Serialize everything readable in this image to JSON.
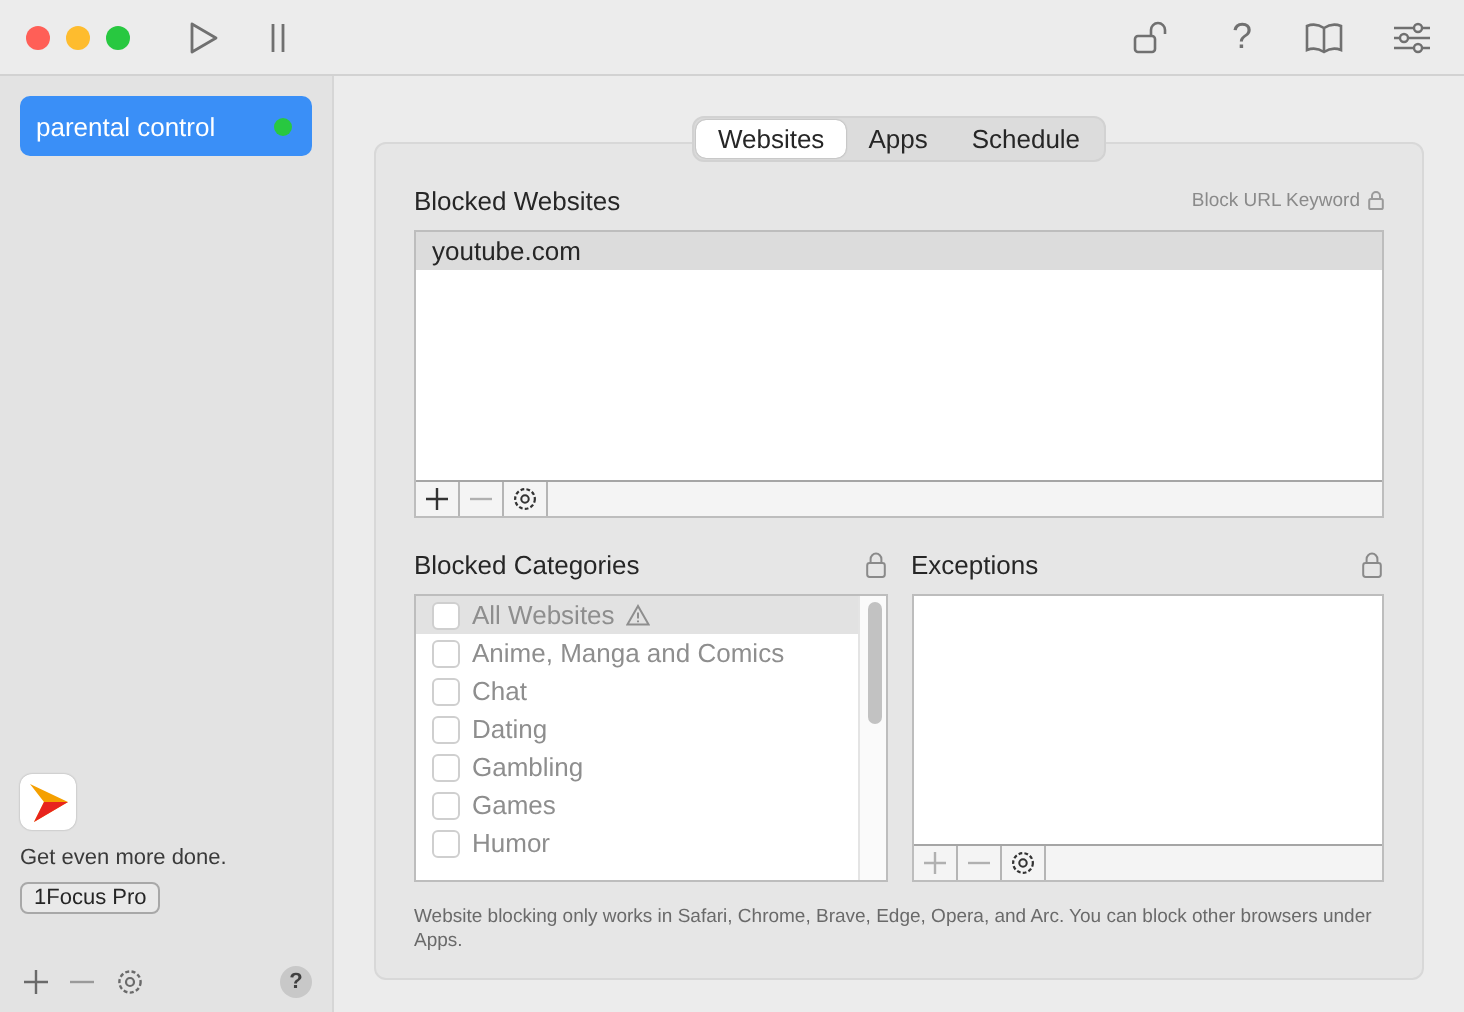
{
  "toolbar": {
    "help_label": "?"
  },
  "sidebar": {
    "items": [
      {
        "label": "parental control",
        "selected": true,
        "color": "#28c840"
      }
    ],
    "promo": {
      "text": "Get even more done.",
      "button": "1Focus Pro"
    },
    "footer": {
      "help_label": "?"
    }
  },
  "tabs": [
    {
      "label": "Websites",
      "selected": true
    },
    {
      "label": "Apps",
      "selected": false
    },
    {
      "label": "Schedule",
      "selected": false
    }
  ],
  "blocked_websites": {
    "title": "Blocked Websites",
    "link": "Block URL Keyword",
    "locked": true,
    "rows": [
      {
        "label": "youtube.com",
        "selected": true
      }
    ],
    "tools": [
      {
        "kind": "add",
        "disabled": false
      },
      {
        "kind": "remove",
        "disabled": true
      },
      {
        "kind": "settings",
        "disabled": false
      }
    ]
  },
  "blocked_categories": {
    "title": "Blocked Categories",
    "locked": true,
    "items": [
      {
        "label": "All Websites",
        "warning": true,
        "checked": false,
        "selected": true,
        "disabled": true
      },
      {
        "label": "Anime, Manga and Comics",
        "warning": false,
        "checked": false,
        "selected": false,
        "disabled": true
      },
      {
        "label": "Chat",
        "warning": false,
        "checked": false,
        "selected": false,
        "disabled": true
      },
      {
        "label": "Dating",
        "warning": false,
        "checked": false,
        "selected": false,
        "disabled": true
      },
      {
        "label": "Gambling",
        "warning": false,
        "checked": false,
        "selected": false,
        "disabled": true
      },
      {
        "label": "Games",
        "warning": false,
        "checked": false,
        "selected": false,
        "disabled": true
      },
      {
        "label": "Humor",
        "warning": false,
        "checked": false,
        "selected": false,
        "disabled": true
      }
    ]
  },
  "exceptions": {
    "title": "Exceptions",
    "locked": true,
    "tools": [
      {
        "kind": "add",
        "disabled": true
      },
      {
        "kind": "remove",
        "disabled": true
      },
      {
        "kind": "settings",
        "disabled": false
      }
    ]
  },
  "note": "Website blocking only works in Safari, Chrome, Brave, Edge, Opera, and Arc. You can block other browsers under Apps."
}
